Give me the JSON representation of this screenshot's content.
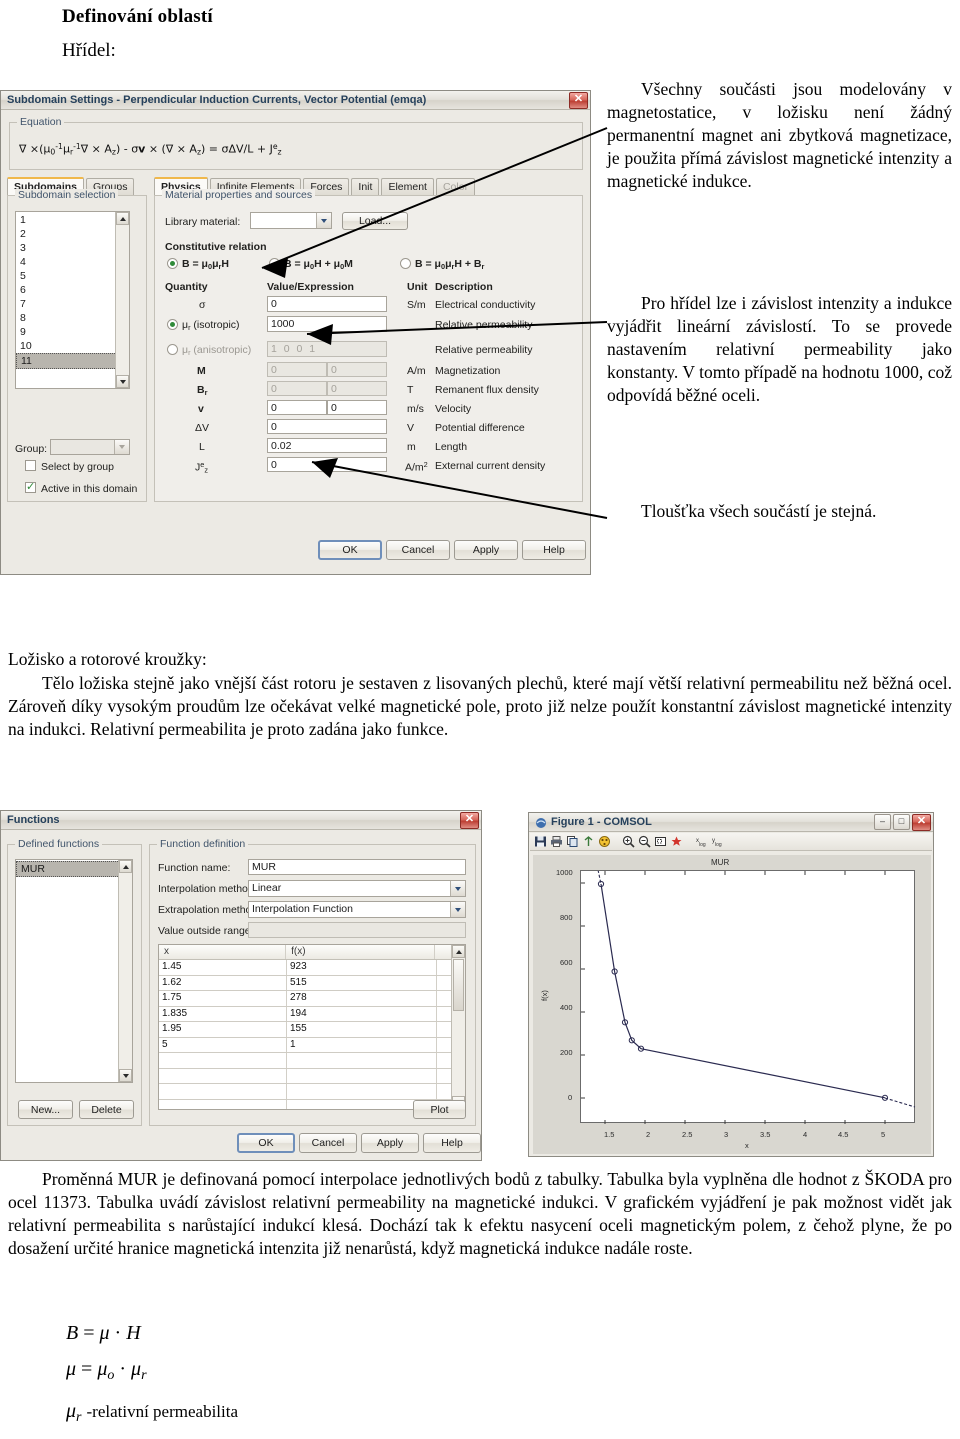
{
  "document": {
    "heading": "Definování oblastí",
    "subheading": "Hřídel:",
    "para_right_1": "Všechny součásti jsou modelovány v magnetostatice, v ložisku není žádný permanentní magnet ani zbytková magnetizace, je použita přímá závislost magnetické intenzity a magnetické indukce.",
    "para_right_2": "Pro hřídel lze i závislost intenzity a indukce vyjádřit lineární závislostí. To se provede nastavením relativní permeability jako konstanty. V tomto případě na hodnotu 1000, což odpovídá běžné oceli.",
    "para_right_3": "Tloušťka všech součástí je stejná.",
    "section2_heading": "Ložisko a rotorové kroužky:",
    "para_mid": "Tělo ložiska stejně jako vnější část rotoru je sestaven z lisovaných plechů, které mají větší relativní permeabilitu než běžná ocel. Zároveň díky vysokým proudům lze očekávat velké magnetické pole, proto již nelze použít konstantní závislost magnetické intenzity na indukci. Relativní permeabilita je proto zadána jako funkce.",
    "para_bottom": "Proměnná MUR je definovaná pomocí interpolace jednotlivých bodů z tabulky. Tabulka byla vyplněna dle hodnot z ŠKODA pro ocel 11373. Tabulka uvádí závislost relativní permeability na magnetické indukci. V grafickém vyjádření je pak možnost vidět jak relativní permeabilita s narůstající indukcí klesá. Dochází tak k efektu nasycení oceli magnetickým polem, z čehož plyne, že po dosažení určité hranice magnetická intenzita již nenarůstá, když magnetická indukce nadále roste.",
    "formula_1": "B = μ · H",
    "formula_2": "μ = μo · μr",
    "formula_3_sym": "μr",
    "formula_3_text": "-relativní permeabilita"
  },
  "subdomain_dialog": {
    "title": "Subdomain Settings - Perpendicular Induction Currents, Vector Potential (emqa)",
    "close_label": "✕",
    "equation_group_label": "Equation",
    "equation_text": "∇ × (μ0-1μr-1∇ × Az) - σv × (∇ × Az) = σΔV/L + Jez",
    "left_tabs": [
      {
        "label": "Subdomains",
        "active": true
      },
      {
        "label": "Groups",
        "active": false
      }
    ],
    "selection_group_label": "Subdomain selection",
    "subdomain_items": [
      "1",
      "2",
      "3",
      "4",
      "5",
      "6",
      "7",
      "8",
      "9",
      "10",
      "11"
    ],
    "selected_subdomain": "11",
    "group_label": "Group:",
    "group_value": "",
    "select_by_group_label": "Select by group",
    "select_by_group_checked": false,
    "active_in_domain_label": "Active in this domain",
    "active_in_domain_checked": true,
    "right_tabs": [
      {
        "label": "Physics",
        "active": true,
        "disabled": false
      },
      {
        "label": "Infinite Elements",
        "active": false,
        "disabled": false
      },
      {
        "label": "Forces",
        "active": false,
        "disabled": false
      },
      {
        "label": "Init",
        "active": false,
        "disabled": false
      },
      {
        "label": "Element",
        "active": false,
        "disabled": false
      },
      {
        "label": "Color",
        "active": false,
        "disabled": true
      }
    ],
    "material_group_label": "Material properties and sources",
    "library_material_label": "Library material:",
    "library_material_value": "",
    "load_button": "Load...",
    "constitutive_relation_label": "Constitutive relation",
    "constitutive_options": [
      {
        "label": "B = μ0μrH",
        "selected": true
      },
      {
        "label": "B = μ0H + μ0M",
        "selected": false
      },
      {
        "label": "B = μ0μrH + Br",
        "selected": false
      }
    ],
    "table_headers": [
      "Quantity",
      "Value/Expression",
      "Unit",
      "Description"
    ],
    "rows": [
      {
        "quantity": "σ",
        "value": "0",
        "value2": "",
        "unit": "S/m",
        "description": "Electrical conductivity",
        "disabled": false,
        "radio": null,
        "twofields": false
      },
      {
        "quantity": "μr (isotropic)",
        "value": "1000",
        "value2": "",
        "unit": "",
        "description": "Relative permeability",
        "disabled": false,
        "radio": "on",
        "twofields": false
      },
      {
        "quantity": "μr (anisotropic)",
        "value": "1 0 0 1",
        "value2": "",
        "unit": "",
        "description": "Relative permeability",
        "disabled": true,
        "radio": "off",
        "twofields": false
      },
      {
        "quantity": "M",
        "value": "0",
        "value2": "0",
        "unit": "A/m",
        "description": "Magnetization",
        "disabled": true,
        "radio": null,
        "twofields": true
      },
      {
        "quantity": "Br",
        "value": "0",
        "value2": "0",
        "unit": "T",
        "description": "Remanent flux density",
        "disabled": true,
        "radio": null,
        "twofields": true
      },
      {
        "quantity": "v",
        "value": "0",
        "value2": "0",
        "unit": "m/s",
        "description": "Velocity",
        "disabled": false,
        "radio": null,
        "twofields": true
      },
      {
        "quantity": "ΔV",
        "value": "0",
        "value2": "",
        "unit": "V",
        "description": "Potential difference",
        "disabled": false,
        "radio": null,
        "twofields": false
      },
      {
        "quantity": "L",
        "value": "0.02",
        "value2": "",
        "unit": "m",
        "description": "Length",
        "disabled": false,
        "radio": null,
        "twofields": false
      },
      {
        "quantity": "Jez",
        "value": "0",
        "value2": "",
        "unit": "A/m2",
        "description": "External current density",
        "disabled": false,
        "radio": null,
        "twofields": false
      }
    ],
    "buttons": [
      "OK",
      "Cancel",
      "Apply",
      "Help"
    ]
  },
  "functions_dialog": {
    "title": "Functions",
    "close_label": "✕",
    "defined_functions_label": "Defined functions",
    "defined_functions": [
      "MUR"
    ],
    "selected_function": "MUR",
    "new_button": "New...",
    "delete_button": "Delete",
    "function_definition_label": "Function definition",
    "function_name_label": "Function name:",
    "function_name_value": "MUR",
    "interpolation_method_label": "Interpolation method:",
    "interpolation_method_value": "Linear",
    "extrapolation_method_label": "Extrapolation method:",
    "extrapolation_method_value": "Interpolation Function",
    "value_outside_range_label": "Value outside range:",
    "value_outside_range_value": "",
    "grid_headers": [
      "x",
      "f(x)"
    ],
    "grid_rows": [
      [
        "1.45",
        "923"
      ],
      [
        "1.62",
        "515"
      ],
      [
        "1.75",
        "278"
      ],
      [
        "1.835",
        "194"
      ],
      [
        "1.95",
        "155"
      ],
      [
        "5",
        "1"
      ],
      [
        "",
        ""
      ],
      [
        "",
        ""
      ],
      [
        "",
        ""
      ],
      [
        "",
        ""
      ]
    ],
    "plot_button": "Plot",
    "buttons": [
      "OK",
      "Cancel",
      "Apply",
      "Help"
    ]
  },
  "figure_window": {
    "title": "Figure 1 - COMSOL",
    "minimize_label": "–",
    "maximize_label": "□",
    "close_label": "✕",
    "toolbar_icons": [
      "save-icon",
      "print-icon",
      "copy-icon",
      "annotation-icon",
      "colormap-icon",
      "zoom-in-icon",
      "zoom-out-icon",
      "zoom-window-icon",
      "zoom-extents-icon",
      "log-x-icon",
      "log-y-icon"
    ]
  },
  "chart_data": {
    "type": "line",
    "title": "MUR",
    "xlabel": "x",
    "ylabel": "f(x)",
    "x": [
      1.45,
      1.62,
      1.75,
      1.835,
      1.95,
      5
    ],
    "y": [
      923,
      515,
      278,
      194,
      155,
      1
    ],
    "xlim": [
      1.2,
      5.4
    ],
    "ylim": [
      -120,
      1060
    ],
    "xticks": [
      1.5,
      2,
      2.5,
      3,
      3.5,
      4,
      4.5,
      5
    ],
    "xticklabels": [
      "1.5",
      "2",
      "2.5",
      "3",
      "3.5",
      "4",
      "4.5",
      "5"
    ],
    "yticks": [
      0,
      200,
      400,
      600,
      800,
      1000
    ],
    "yticklabels": [
      "0",
      "200",
      "400",
      "600",
      "800",
      "1000"
    ],
    "grid": false,
    "legend": null,
    "marker": "circle",
    "line_color": "#2a2a50"
  }
}
